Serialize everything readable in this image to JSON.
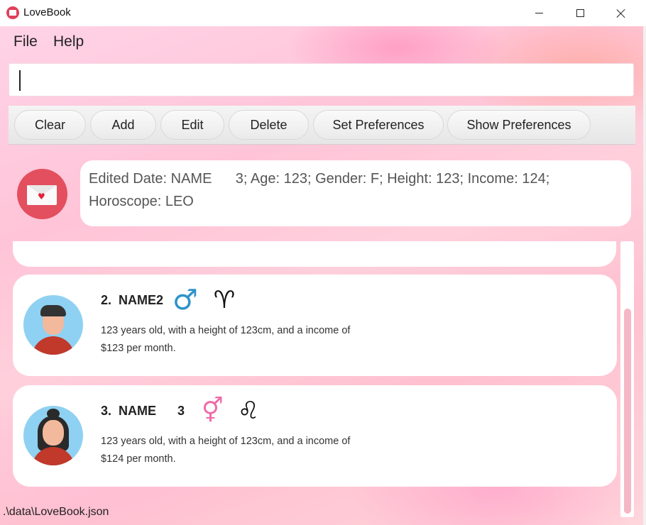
{
  "window": {
    "title": "LoveBook",
    "icon": "lovebook-app-icon",
    "controls": [
      "minimize-icon",
      "maximize-icon",
      "close-icon"
    ]
  },
  "menu": {
    "file": "File",
    "help": "Help"
  },
  "command_box": {
    "value": "",
    "placeholder": ""
  },
  "toolbar": {
    "buttons": [
      "Clear",
      "Add",
      "Edit",
      "Delete",
      "Set Preferences",
      "Show Preferences"
    ]
  },
  "result": {
    "icon": "envelope-heart-icon",
    "text": "Edited Date: NAME      3; Age: 123; Gender: F; Height: 123; Income: 124;\nHoroscope: LEO"
  },
  "list": {
    "cards": [
      {
        "index": "2.",
        "name": "NAME2",
        "gender_icon": "male-icon",
        "zodiac_icon": "aries-icon",
        "avatar": "male-avatar",
        "description": "123 years old, with a height of 123cm, and a income of $123 per month."
      },
      {
        "index": "3.",
        "name": "NAME      3",
        "gender_icon": "female-icon",
        "zodiac_icon": "leo-icon",
        "avatar": "female-avatar",
        "description": "123 years old, with a height of 123cm, and a income of $124 per month."
      }
    ]
  },
  "status": {
    "path": ".\\data\\LoveBook.json"
  },
  "colors": {
    "accent": "#e34f5e",
    "male": "#2f93c9",
    "female": "#f06aa8",
    "scroll_thumb": "#f5b6c5"
  }
}
